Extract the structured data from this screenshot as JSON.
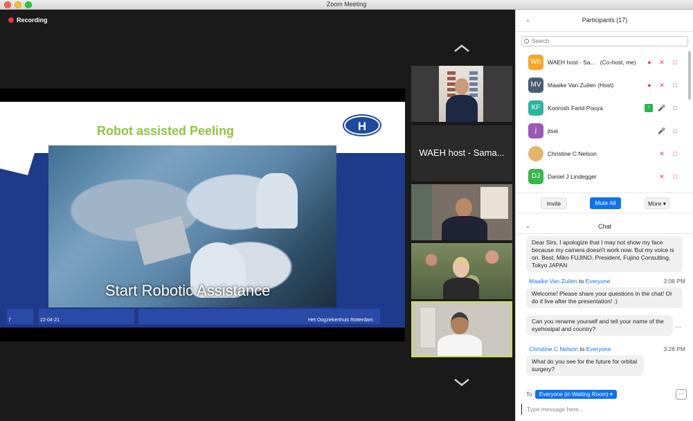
{
  "window": {
    "title": "Zoom Meeting"
  },
  "recording": {
    "label": "Recording"
  },
  "slide": {
    "title": "Robot assisted Peeling",
    "logo_text": "H",
    "photo_caption": "Start Robotic Assistance",
    "footer_page": "7",
    "footer_date": "22-04-21",
    "footer_org": "Het Oogziekenhuis Rotterdam"
  },
  "tiles": [
    {
      "type": "video"
    },
    {
      "type": "name",
      "label": "WAEH host - Sama..."
    },
    {
      "type": "video"
    },
    {
      "type": "video"
    },
    {
      "type": "video",
      "active": true
    }
  ],
  "participants": {
    "title": "Participants (17)",
    "search_placeholder": "Search",
    "items": [
      {
        "initials": "Wh",
        "name": "WAEH host - Sa...",
        "role": "(Co-host, me)",
        "color": "#f5a623",
        "rec": true,
        "mic": "muted",
        "cam": "off"
      },
      {
        "initials": "MV",
        "name": "Maaike Van Zuilen (Host)",
        "role": "",
        "color": "#4a5d72",
        "rec": true,
        "mic": "muted",
        "cam": "on"
      },
      {
        "initials": "KF",
        "name": "Koorosh Farid Pouya",
        "role": "",
        "color": "#2bb5a0",
        "share": true,
        "mic": "on",
        "cam": "on"
      },
      {
        "initials": "j",
        "name": "jtsai",
        "role": "",
        "color": "#9b59b6",
        "mic": "on",
        "cam": "on"
      },
      {
        "initials": "",
        "name": "Christine C Nelson",
        "role": "",
        "color": "#e2b56b",
        "mic": "muted",
        "cam": "off"
      },
      {
        "initials": "DJ",
        "name": "Daniel J Lindegger",
        "role": "",
        "color": "#39b54a",
        "mic": "muted",
        "cam": "off"
      }
    ],
    "buttons": {
      "invite": "Invite",
      "mute_all": "Mute All",
      "more": "More"
    }
  },
  "chat": {
    "title": "Chat",
    "messages": [
      {
        "text": "Dear Sirs, I apologize that I may not show my face because my camera doesn't work now. But my voice is on. Best, Miko FUJINO, President, Fujino Consulting, Tokyo JAPAN"
      },
      {
        "sender": "Maaike Van Zuilen",
        "to_word": "to",
        "recipient": "Everyone",
        "time": "3:08 PM"
      },
      {
        "text": "Welcome! Please share your questions in the chat! Or do it live after the presentation! :)"
      },
      {
        "text": "Can you rename yourself and tell your name of the eyehosipal and country?"
      },
      {
        "sender": "Christine C Nelson",
        "to_word": "to",
        "recipient": "Everyone",
        "time": "3:28 PM"
      },
      {
        "text": "What do you see for the future for orbital surgery?"
      }
    ],
    "to_label": "To:",
    "to_value": "Everyone (in Waiting Room)",
    "input_placeholder": "Type message here..."
  }
}
